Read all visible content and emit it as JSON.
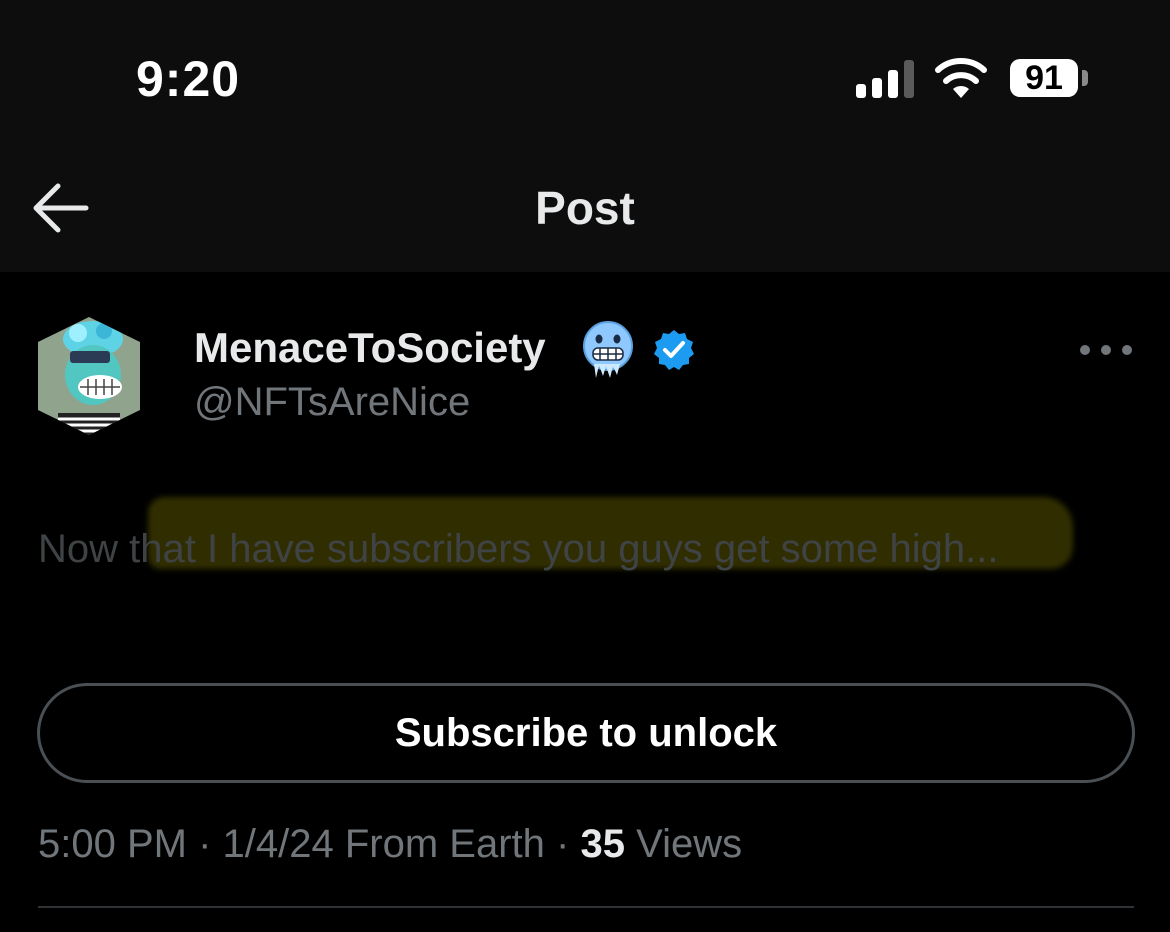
{
  "status_bar": {
    "time": "9:20",
    "battery_level": "91",
    "signal_bars_active": 3,
    "signal_bars_total": 4,
    "wifi": true
  },
  "nav": {
    "title": "Post",
    "back_icon": "arrow-left-icon"
  },
  "post": {
    "author_name": "MenaceToSociety",
    "author_emoji": "cold-face-emoji",
    "verified_icon": "verified-badge-icon",
    "handle": "@NFTsAreNice",
    "more_icon": "more-horizontal-icon",
    "text": "Now that I have subscribers you guys get some high...",
    "subscribe_button": "Subscribe to unlock",
    "time": "5:00 PM",
    "date": "1/4/24",
    "location": "From Earth",
    "views_count": "35",
    "views_label": "Views"
  },
  "colors": {
    "background": "#000000",
    "header_background": "#0d0d0d",
    "primary_text": "#e7e9ea",
    "secondary_text": "#71767b",
    "verified_blue": "#1d9bf0",
    "highlight": "#736e00"
  }
}
